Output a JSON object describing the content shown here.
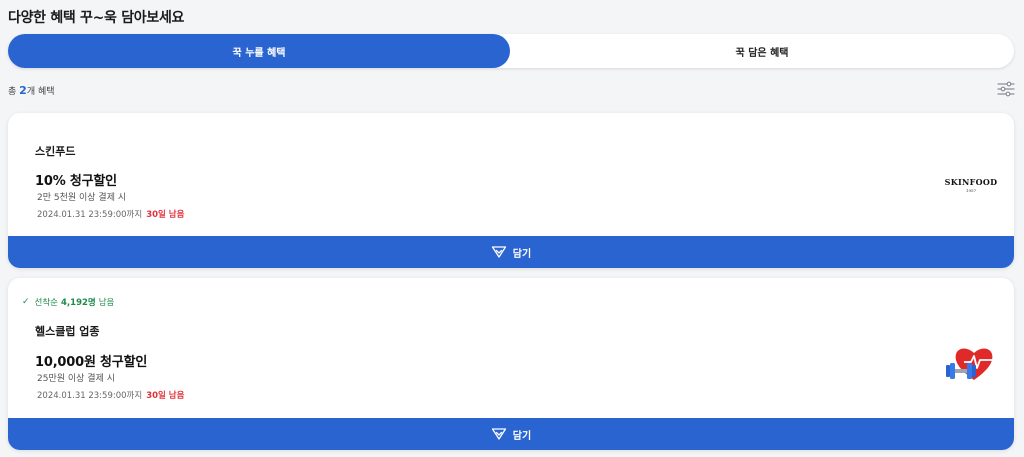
{
  "header": {
    "title": "다양한 혜택 꾸~욱 담아보세요"
  },
  "tabs": [
    {
      "label": "꾹 누를 혜택",
      "active": true
    },
    {
      "label": "꾹 담은 혜택",
      "active": false
    }
  ],
  "summary": {
    "prefix": "총 ",
    "count": "2",
    "suffix": "개 혜택"
  },
  "filter": {
    "icon": "filter-sliders-icon"
  },
  "benefits": [
    {
      "brand": "스킨푸드",
      "discount": "10%  청구할인",
      "condition": "2만 5천원 이상 결제 시",
      "deadline": "2024.01.31 23:59:00까지",
      "remaining": "30일 남음",
      "logo": {
        "name": "SKINFOOD",
        "year": "1957"
      },
      "save_label": "담기"
    },
    {
      "firstcome_prefix": "선착순",
      "firstcome_count": "4,192명",
      "firstcome_suffix": "남음",
      "brand": "헬스클럽 업종",
      "discount": "10,000원  청구할인",
      "condition": "25만원 이상 결제 시",
      "deadline": "2024.01.31 23:59:00까지",
      "remaining": "30일 남음",
      "logo": {
        "icon": "heart-dumbbell-icon"
      },
      "save_label": "담기"
    }
  ],
  "colors": {
    "primary": "#2a64d1",
    "accent_red": "#e0323b",
    "accent_green": "#1e8a4a",
    "background": "#f4f5f7"
  }
}
